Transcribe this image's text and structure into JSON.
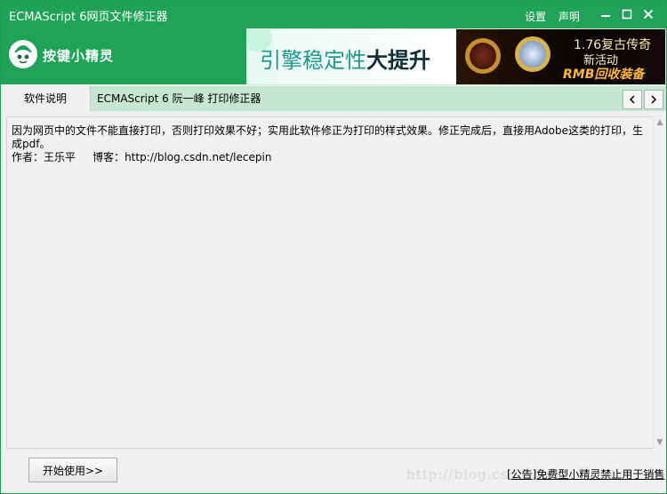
{
  "app": {
    "title": "ECMAScript 6网页文件修正器",
    "links": [
      "设置",
      "声明"
    ],
    "colors": {
      "accent": "#1fa356",
      "tabbar": "#c5e6d1"
    }
  },
  "brand": {
    "name": "按键小精灵",
    "icon": "elf-mascot-icon"
  },
  "ad": {
    "slogan_regular": "引擎稳定性",
    "slogan_bold": "大提升",
    "game_line1": "1.76复古传奇",
    "game_line2": "新活动",
    "game_line3": "RMB回收装备"
  },
  "tabs": [
    {
      "label": "软件说明"
    },
    {
      "label": "ECMAScript 6 阮一峰 打印修正器"
    }
  ],
  "nav": {
    "prev": "‹",
    "next": "›"
  },
  "content": {
    "line1": "因为网页中的文件不能直接打印，否则打印效果不好；实用此软件修正为打印的样式效果。修正完成后，直接用Adobe这类的打印，生成pdf。",
    "line2": "作者：王乐平     博客：http://blog.csdn.net/lecepin"
  },
  "footer": {
    "start_button": "开始使用>>",
    "notice": "[公告]免费型小精灵禁止用于销售",
    "watermark": "http://blog.csdn.net/"
  }
}
